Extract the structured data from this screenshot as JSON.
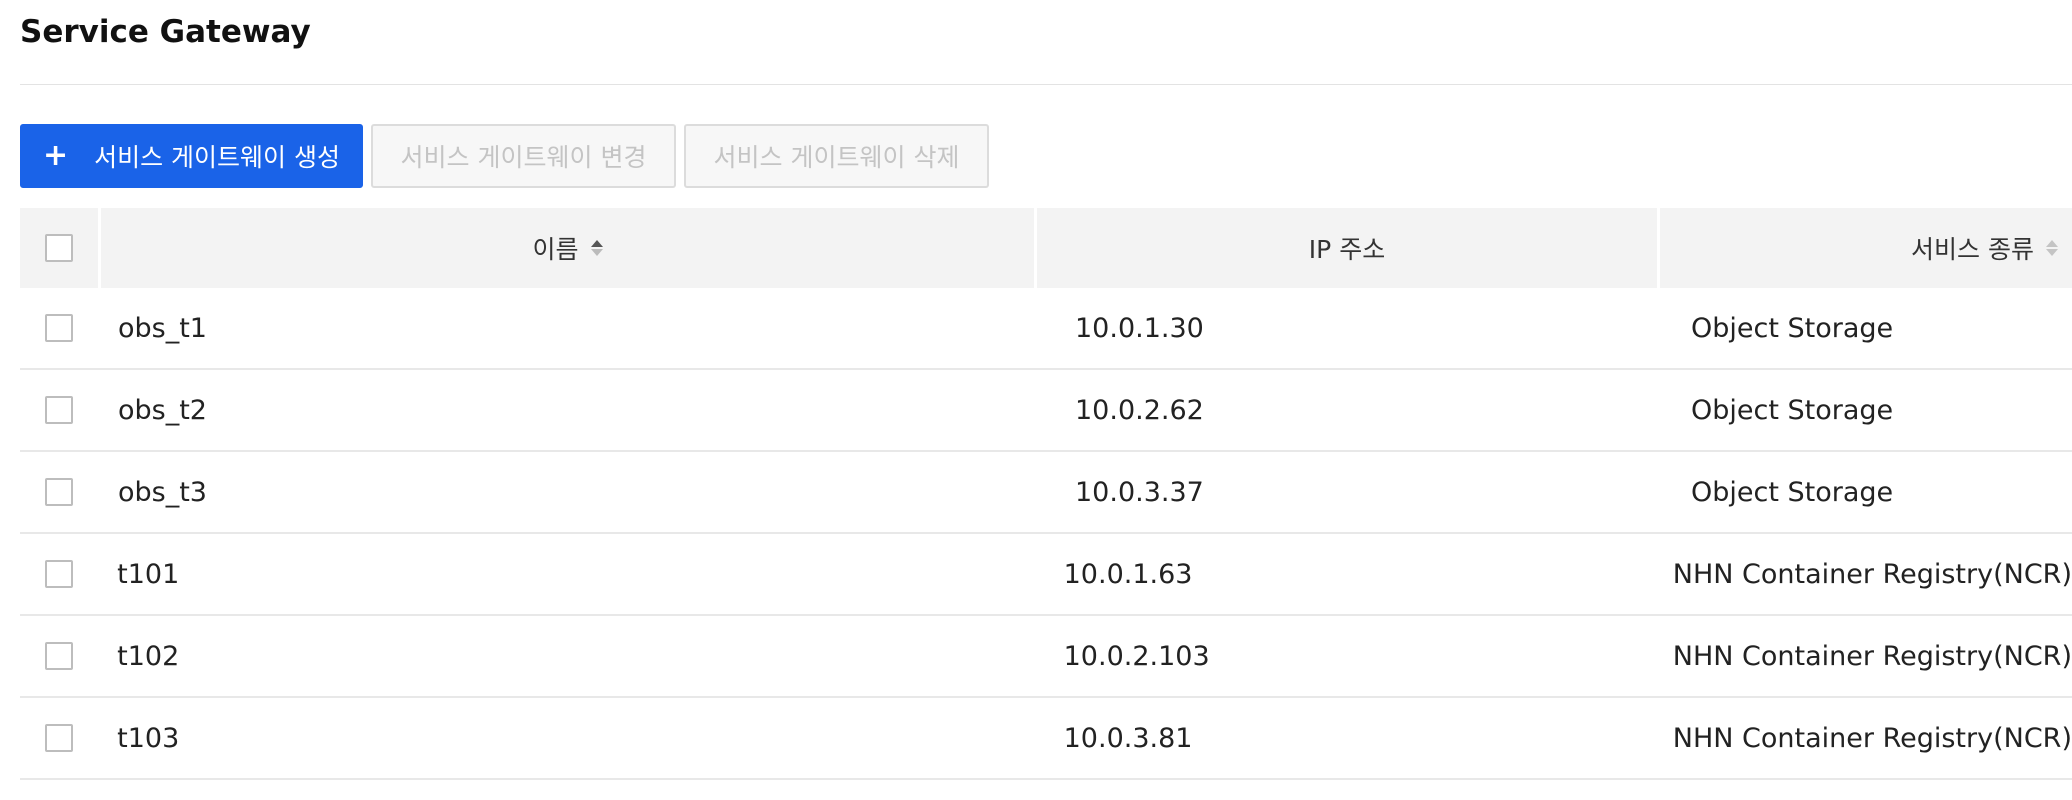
{
  "page": {
    "title": "Service Gateway"
  },
  "toolbar": {
    "create_label": "서비스 게이트웨이 생성",
    "modify_label": "서비스 게이트웨이 변경",
    "delete_label": "서비스 게이트웨이 삭제"
  },
  "table": {
    "columns": {
      "name": "이름",
      "ip": "IP 주소",
      "type": "서비스 종류"
    },
    "rows": [
      {
        "name": "obs_t1",
        "ip": "10.0.1.30",
        "type": "Object Storage"
      },
      {
        "name": "obs_t2",
        "ip": "10.0.2.62",
        "type": "Object Storage"
      },
      {
        "name": "obs_t3",
        "ip": "10.0.3.37",
        "type": "Object Storage"
      },
      {
        "name": "t101",
        "ip": "10.0.1.63",
        "type": "NHN Container Registry(NCR)"
      },
      {
        "name": "t102",
        "ip": "10.0.2.103",
        "type": "NHN Container Registry(NCR)"
      },
      {
        "name": "t103",
        "ip": "10.0.3.81",
        "type": "NHN Container Registry(NCR)"
      }
    ]
  },
  "colors": {
    "primary": "#1a63e8",
    "header_bg": "#f3f3f3",
    "disabled_text": "#c4c4c4",
    "row_border": "#e8e8e8"
  },
  "icons": {
    "create": "plus-icon",
    "sort": "sort-icon",
    "select": "checkbox"
  }
}
